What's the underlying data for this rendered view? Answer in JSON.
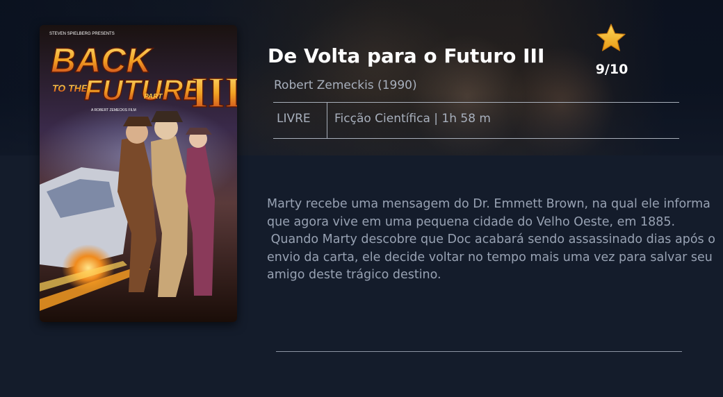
{
  "movie": {
    "title": "De Volta para o Futuro III",
    "director_year": "Robert Zemeckis (1990)",
    "age_rating": "LIVRE",
    "genre_duration": "Ficção Científica | 1h 58 m",
    "score": "9/10",
    "synopsis_lines": [
      "Marty recebe uma mensagem do Dr. Emmett Brown, na qual ele informa que agora vive em uma pequena cidade do Velho Oeste, em 1885.",
      " Quando Marty descobre que Doc acabará sendo assassinado dias após o envio da carta, ele decide voltar no tempo mais uma vez para salvar seu amigo deste trágico destino."
    ]
  },
  "poster": {
    "credit": "STEVEN SPIELBERG PRESENTS",
    "title_line1": "BACK",
    "title_line2": "TO THE",
    "title_line3": "FUTURE",
    "part_label": "PART",
    "part_number": "III",
    "director_credit": "A ROBERT ZEMECKIS FILM"
  },
  "icons": {
    "rating": "star-icon"
  },
  "colors": {
    "page_background": "#141c2b",
    "title": "#ffffff",
    "muted_text": "#a8b0bd",
    "synopsis_text": "#98a2b3",
    "star": "#f5b829",
    "poster_title": "#f3a323"
  }
}
